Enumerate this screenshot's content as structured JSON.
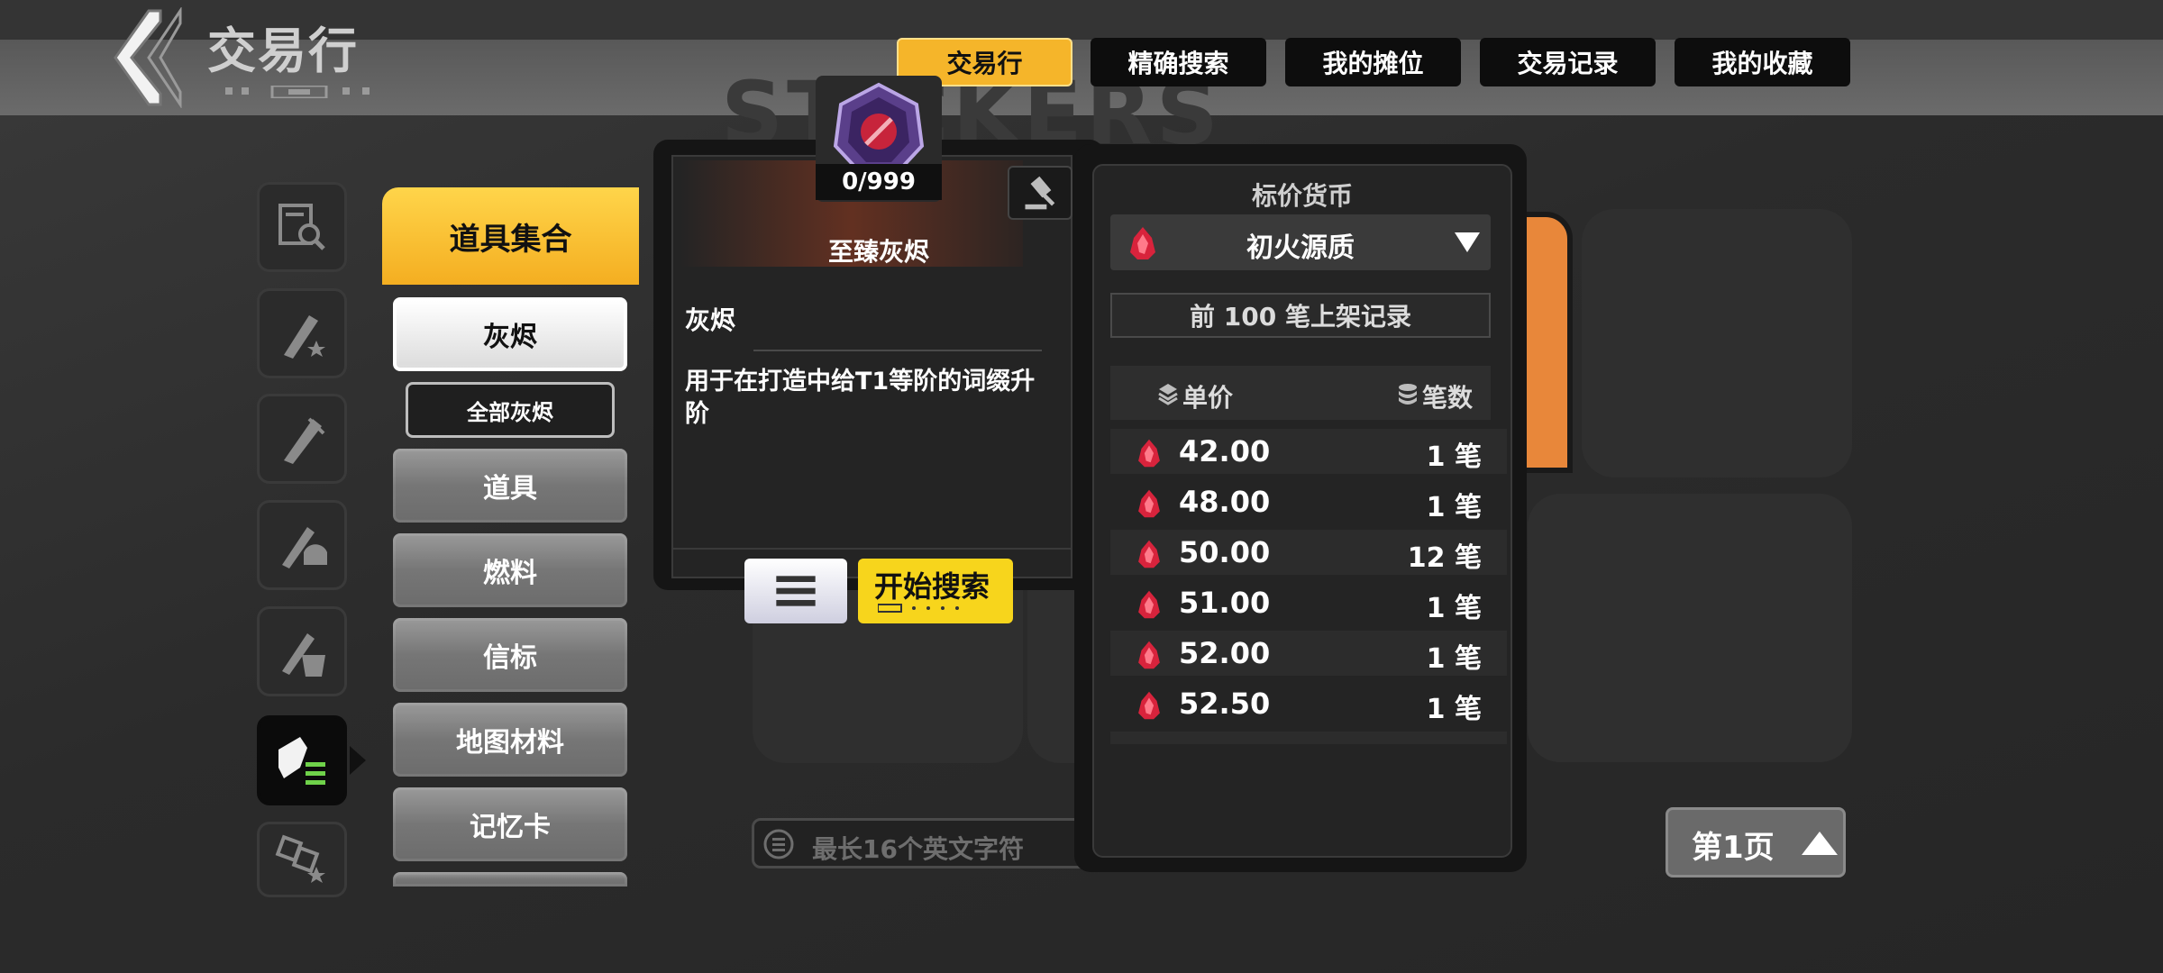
{
  "header": {
    "title": "交易行",
    "tabs": [
      {
        "label": "交易行",
        "active": true
      },
      {
        "label": "精确搜索",
        "active": false
      },
      {
        "label": "我的摊位",
        "active": false
      },
      {
        "label": "交易记录",
        "active": false
      },
      {
        "label": "我的收藏",
        "active": false
      }
    ]
  },
  "background": {
    "watermark": "STICKERS"
  },
  "left_rail": {
    "icons": [
      "search-list-icon",
      "weapon-star-icon",
      "weapon-icon",
      "weapon-helmet-icon",
      "weapon-armor-icon",
      "item-list-icon",
      "map-star-icon"
    ],
    "active_index": 5
  },
  "categories": {
    "header": "道具集合",
    "selected": "灰烬",
    "sub_item": "全部灰烬",
    "items": [
      "灰烬",
      "道具",
      "燃料",
      "信标",
      "地图材料",
      "记忆卡"
    ]
  },
  "item_detail": {
    "count": "0/999",
    "name": "至臻灰烬",
    "category": "灰烬",
    "description": "用于在打造中给T1等阶的词缀升阶"
  },
  "actions": {
    "search_button": "开始搜索",
    "name_placeholder": "最长16个英文字符"
  },
  "price_panel": {
    "currency_label": "标价货币",
    "currency": "初火源质",
    "records_button": "前 100 笔上架记录",
    "col_price": "单价",
    "col_count": "笔数",
    "rows": [
      {
        "price": "42.00",
        "count": "1 笔"
      },
      {
        "price": "48.00",
        "count": "1 笔"
      },
      {
        "price": "50.00",
        "count": "12 笔"
      },
      {
        "price": "51.00",
        "count": "1 笔"
      },
      {
        "price": "52.00",
        "count": "1 笔"
      },
      {
        "price": "52.50",
        "count": "1 笔"
      }
    ]
  },
  "pagination": {
    "label": "第1页"
  },
  "colors": {
    "accent": "#f5b52a",
    "search_yellow": "#f7d51c",
    "panel": "#151515"
  }
}
